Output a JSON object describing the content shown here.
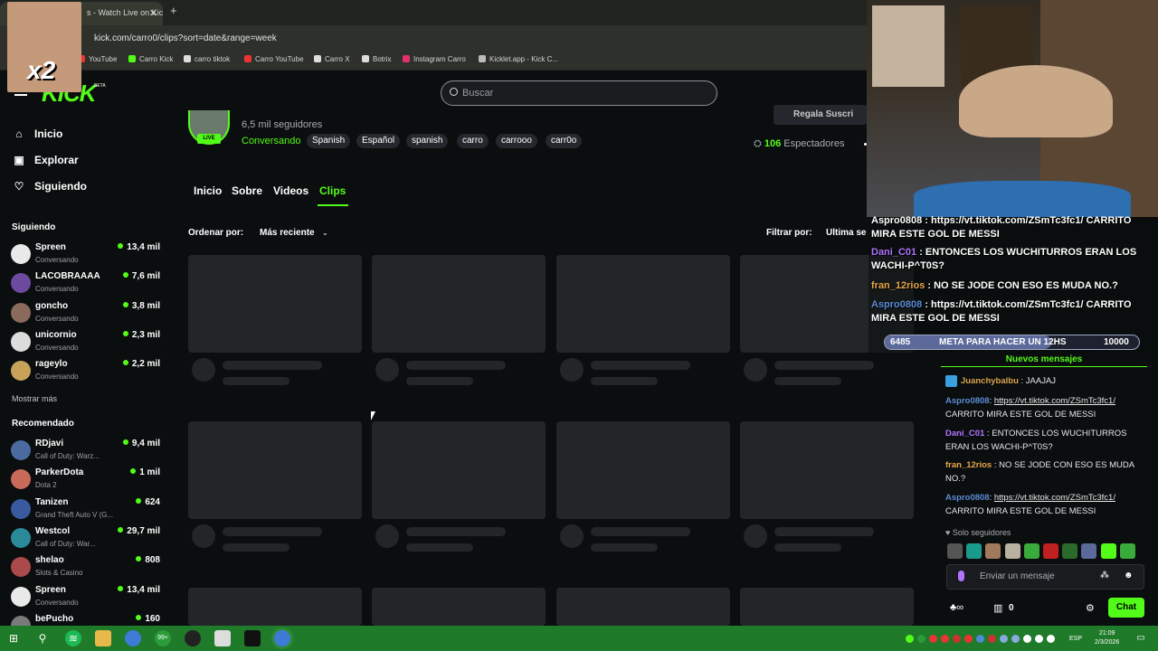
{
  "browser": {
    "tab_title": "s - Watch Live on Kic",
    "new_tab": "+",
    "url": "kick.com/carro0/clips?sort=date&range=week",
    "bookmarks": [
      {
        "label": "YouTube",
        "color": "#e33"
      },
      {
        "label": "Carro Kick",
        "color": "#53fc18"
      },
      {
        "label": "carro tiktok",
        "color": "#ddd"
      },
      {
        "label": "Carro YouTube",
        "color": "#e33"
      },
      {
        "label": "Carro X",
        "color": "#ddd"
      },
      {
        "label": "Botrix",
        "color": "#ddd"
      },
      {
        "label": "Instagram Carro",
        "color": "#e1306c"
      },
      {
        "label": "Kicklet.app - Kick C...",
        "color": "#bbb"
      }
    ]
  },
  "overlay": {
    "multiplier": "x2"
  },
  "header": {
    "logo": "KICK",
    "beta": "BETA",
    "search_placeholder": "Buscar"
  },
  "sidebar": {
    "nav": [
      {
        "label": "Inicio",
        "icon": "home-icon",
        "glyph": "⌂"
      },
      {
        "label": "Explorar",
        "icon": "compass-icon",
        "glyph": "▣"
      },
      {
        "label": "Siguiendo",
        "icon": "heart-icon",
        "glyph": "♡"
      }
    ],
    "following_title": "Siguiendo",
    "following": [
      {
        "name": "Spreen",
        "status": "Conversando",
        "viewers": "13,4 mil"
      },
      {
        "name": "LACOBRAAAA",
        "status": "Conversando",
        "viewers": "7,6 mil"
      },
      {
        "name": "goncho",
        "status": "Conversando",
        "viewers": "3,8 mil"
      },
      {
        "name": "unicornio",
        "status": "Conversando",
        "viewers": "2,3 mil"
      },
      {
        "name": "rageylo",
        "status": "Conversando",
        "viewers": "2,2 mil"
      }
    ],
    "show_more": "Mostrar más",
    "recommended_title": "Recomendado",
    "recommended": [
      {
        "name": "RDjavi",
        "status": "Call of Duty: Warz...",
        "viewers": "9,4 mil"
      },
      {
        "name": "ParkerDota",
        "status": "Dota 2",
        "viewers": "1 mil"
      },
      {
        "name": "Tanizen",
        "status": "Grand Theft Auto V (G...",
        "viewers": "624"
      },
      {
        "name": "Westcol",
        "status": "Call of Duty: War...",
        "viewers": "29,7 mil"
      },
      {
        "name": "shelao",
        "status": "Slots & Casino",
        "viewers": "808"
      },
      {
        "name": "Spreen",
        "status": "Conversando",
        "viewers": "13,4 mil"
      },
      {
        "name": "bePucho",
        "status": "",
        "viewers": "160"
      }
    ]
  },
  "channel": {
    "live": "LIVE",
    "followers": "6,5 mil seguidores",
    "category": "Conversando",
    "tags": [
      "Spanish",
      "Español",
      "spanish",
      "carro",
      "carrooo",
      "carr0o"
    ],
    "viewers_count": "106",
    "viewers_label": "Espectadores",
    "gift_label": "Regala Suscri"
  },
  "tabs": [
    "Inicio",
    "Sobre",
    "Videos",
    "Clips"
  ],
  "sort": {
    "label": "Ordenar por:",
    "value": "Más reciente"
  },
  "filter": {
    "label": "Filtrar por:",
    "value": "Última sem"
  },
  "overlay_chat": {
    "line0": "Aspro0808 : https://vt.tiktok.com/ZSmTc3fc1/ CARRITO MIRA ESTE GOL DE MESSI",
    "msgs": [
      {
        "user": "Dani_C01",
        "text": " : ENTONCES LOS WUCHITURROS ERAN LOS WACHI-P^T0S?"
      },
      {
        "user": "fran_12rios",
        "text": " : NO SE JODE CON ESO ES MUDA NO.?"
      },
      {
        "user": "Aspro0808",
        "text": " : https://vt.tiktok.com/ZSmTc3fc1/ CARRITO MIRA ESTE GOL DE MESSI"
      }
    ],
    "goal_current": "6485",
    "goal_text": "META PARA HACER UN 12HS",
    "goal_target": "10000",
    "goal_progress": 0.6485
  },
  "chat": {
    "new_messages": "Nuevos mensajes",
    "messages": [
      {
        "user": "Juanchybalbu",
        "text": ": JAAJAJ",
        "link": ""
      },
      {
        "user": "Aspro0808",
        "text": "CARRITO MIRA ESTE GOL DE MESSI",
        "link": "https://vt.tiktok.com/ZSmTc3fc1/"
      },
      {
        "user": "Dani_C01",
        "text": ": ENTONCES LOS WUCHITURROS ERAN LOS WACHI-P^T0S?",
        "link": ""
      },
      {
        "user": "fran_12rios",
        "text": ": NO SE JODE CON ESO ES MUDA NO.?",
        "link": ""
      },
      {
        "user": "Aspro0808",
        "text": "CARRITO MIRA ESTE GOL DE MESSI",
        "link": "https://vt.tiktok.com/ZSmTc3fc1/"
      }
    ],
    "followers_only": "♥ Solo seguidores",
    "input_placeholder": "Enviar un mensaje",
    "points": "0",
    "send_button": "Chat"
  },
  "taskbar": {
    "lang": "ESP",
    "time": "21:09",
    "date": "2/3/2026",
    "badge": "99+"
  },
  "colors": {
    "accent": "#53fc18",
    "bg": "#0b0e0f",
    "skeleton": "#232629",
    "taskbar": "#1f7a2a"
  }
}
